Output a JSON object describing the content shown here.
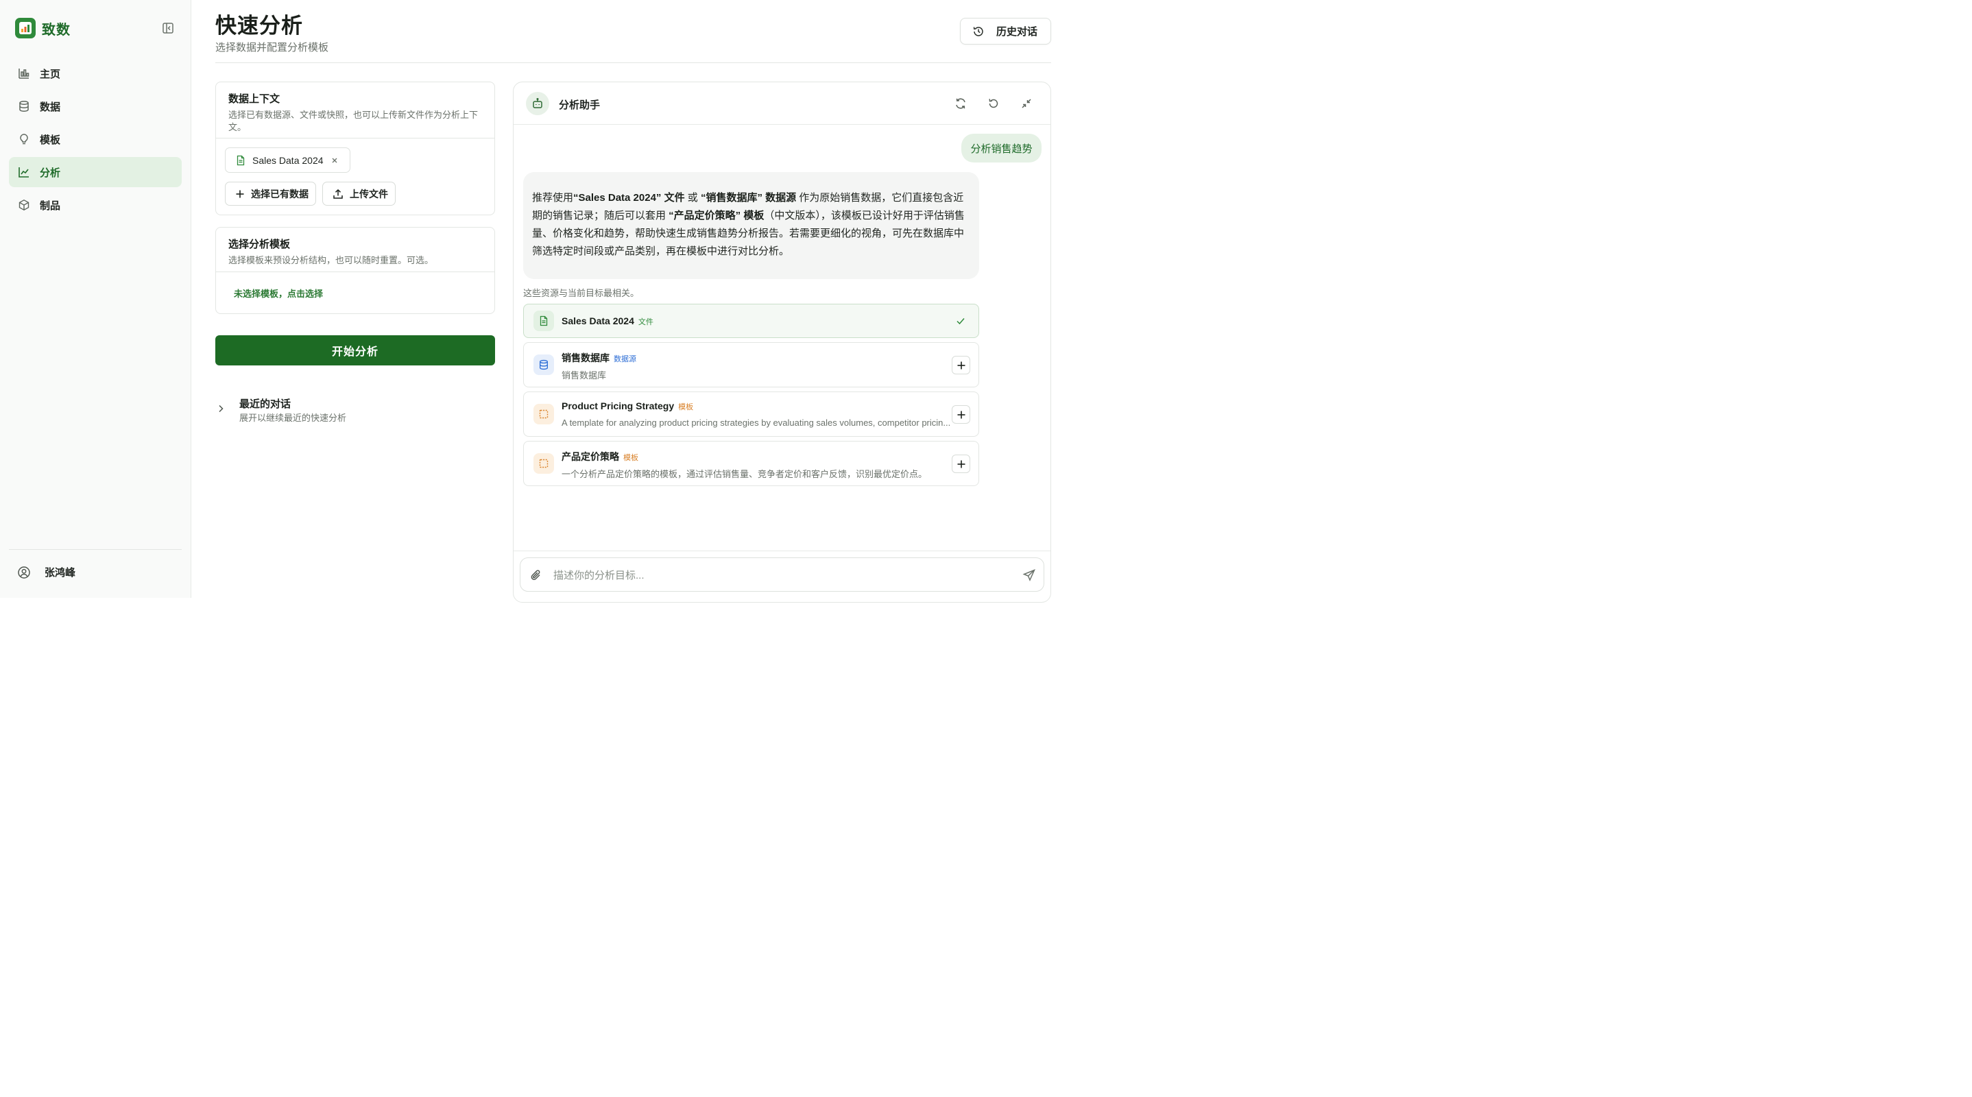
{
  "sidebar": {
    "brand": "致数",
    "items": [
      {
        "label": "主页",
        "icon": "bar-chart-icon"
      },
      {
        "label": "数据",
        "icon": "database-icon"
      },
      {
        "label": "模板",
        "icon": "lightbulb-icon"
      },
      {
        "label": "分析",
        "icon": "line-chart-icon",
        "active": true
      },
      {
        "label": "制品",
        "icon": "package-icon"
      }
    ],
    "user_name": "张鸿峰"
  },
  "header": {
    "title": "快速分析",
    "subtitle": "选择数据并配置分析模板",
    "history_button": "历史对话"
  },
  "data_context": {
    "title": "数据上下文",
    "description": "选择已有数据源、文件或快照，也可以上传新文件作为分析上下文。",
    "selected_chip": "Sales Data 2024",
    "select_existing_button": "选择已有数据",
    "upload_button": "上传文件"
  },
  "template_section": {
    "title": "选择分析模板",
    "description": "选择模板来预设分析结构，也可以随时重置。可选。",
    "pick_link": "未选择模板，点击选择"
  },
  "start_button": "开始分析",
  "recent": {
    "title": "最近的对话",
    "description": "展开以继续最近的快速分析"
  },
  "chat": {
    "title": "分析助手",
    "user_message": "分析销售趋势",
    "assistant_message": {
      "p1": "推荐使用",
      "b1": "“Sales Data 2024” 文件",
      "p2": " 或 ",
      "b2": "“销售数据库” 数据源",
      "p3": " 作为原始销售数据，它们直接包含近期的销售记录；随后可以套用 ",
      "b3": "“产品定价策略” 模板",
      "p4": "（中文版本），该模板已设计好用于评估销售量、价格变化和趋势，帮助快速生成销售趋势分析报告。若需要更细化的视角，可先在数据库中筛选特定时间段或产品类别，再在模板中进行对比分析。"
    },
    "related_note": "这些资源与当前目标最相关。",
    "resources": [
      {
        "name": "Sales Data 2024",
        "tag": "文件",
        "tag_color": "#2f8a3b",
        "description": "",
        "selected": true
      },
      {
        "name": "销售数据库",
        "tag": "数据源",
        "tag_color": "#2f6fd6",
        "description": "销售数据库",
        "selected": false
      },
      {
        "name": "Product Pricing Strategy",
        "tag": "模板",
        "tag_color": "#d9822b",
        "description": "A template for analyzing product pricing strategies by evaluating sales volumes, competitor pricin...",
        "selected": false
      },
      {
        "name": "产品定价策略",
        "tag": "模板",
        "tag_color": "#d9822b",
        "description": "一个分析产品定价策略的模板，通过评估销售量、竞争者定价和客户反馈，识别最优定价点。",
        "selected": false
      }
    ],
    "input_placeholder": "描述你的分析目标...",
    "input_value": ""
  },
  "colors": {
    "accent": "#1d6b24",
    "active_nav_bg": "#e3f1e3"
  }
}
